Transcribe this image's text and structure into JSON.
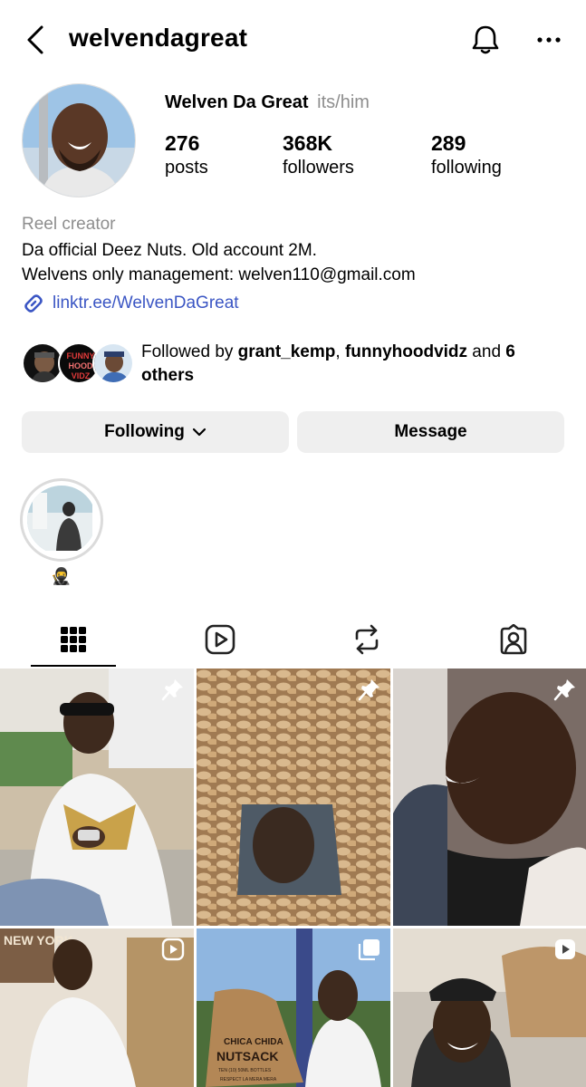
{
  "header": {
    "username": "welvendagreat"
  },
  "profile": {
    "display_name": "Welven Da Great",
    "pronouns": "its/him",
    "stats": [
      {
        "value": "276",
        "label": "posts"
      },
      {
        "value": "368K",
        "label": "followers"
      },
      {
        "value": "289",
        "label": "following"
      }
    ],
    "category": "Reel creator",
    "bio_line1": "Da official Deez Nuts. Old account 2M.",
    "bio_line2": "Welvens only management: welven110@gmail.com",
    "link": "linktr.ee/WelvenDaGreat"
  },
  "followed_by": {
    "prefix": "Followed by ",
    "user1": "grant_kemp",
    "sep": ", ",
    "user2": "funnyhoodvidz",
    "and": " and ",
    "count": "6",
    "suffix": "others",
    "avatar_text": "FUNNY HOOD VIDZ"
  },
  "actions": {
    "following_label": "Following",
    "message_label": "Message"
  },
  "highlight": {
    "label": "🥷"
  },
  "tabs": [
    "grid-icon",
    "reels-icon",
    "reposts-icon",
    "tagged-icon"
  ],
  "posts": [
    {
      "kind": "pinned"
    },
    {
      "kind": "pinned"
    },
    {
      "kind": "pinned"
    },
    {
      "kind": "reel"
    },
    {
      "kind": "carousel"
    },
    {
      "kind": "reel"
    }
  ],
  "post_text": {
    "ny_sign": "NEW YORK",
    "sack_brand": "CHICA CHIDA",
    "sack_name": "NUTSACK",
    "sack_sub": "TEN (10) 50ML BOTTLES",
    "sack_foot": "RESPECT LA MERA MERA"
  },
  "colors": {
    "link": "#3b56c4",
    "button_bg": "#efefef",
    "muted": "#8e8e8e"
  }
}
